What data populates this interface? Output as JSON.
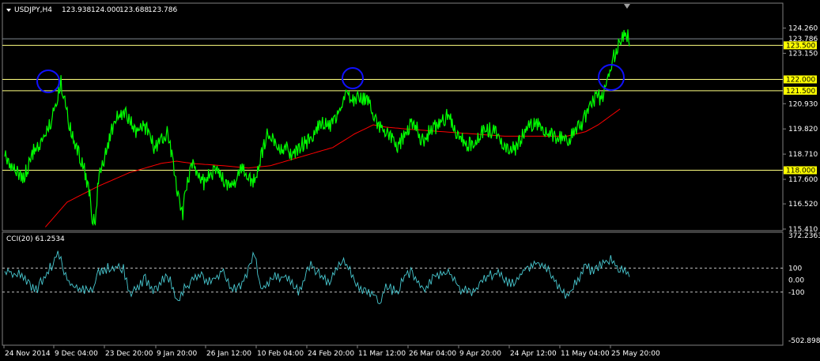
{
  "chart_data": [
    {
      "type": "line",
      "title": "USDJPY,H4",
      "ohlc": {
        "open": "123.938",
        "high": "124.000",
        "low": "123.688",
        "close": "123.786"
      },
      "ylim": [
        115.41,
        124.8
      ],
      "price_ticks": [
        "124.260",
        "123.150",
        "120.930",
        "119.820",
        "118.710",
        "117.600",
        "116.520",
        "115.410"
      ],
      "current_price": "123.786",
      "levels": [
        "123.500",
        "122.000",
        "121.500",
        "118.000"
      ],
      "x_labels": [
        "24 Nov 2014",
        "9 Dec 04:00",
        "23 Dec 20:00",
        "9 Jan 20:00",
        "26 Jan 12:00",
        "10 Feb 04:00",
        "24 Feb 20:00",
        "11 Mar 12:00",
        "26 Mar 04:00",
        "9 Apr 20:00",
        "24 Apr 12:00",
        "11 May 04:00",
        "25 May 20:00"
      ],
      "series": [
        {
          "color": "#00ff00",
          "anchors": [
            [
              0,
              118.6
            ],
            [
              3,
              118.0
            ],
            [
              6,
              117.6
            ],
            [
              9,
              118.8
            ],
            [
              12,
              119.3
            ],
            [
              15,
              120.2
            ],
            [
              17,
              121.3
            ],
            [
              18,
              121.9
            ],
            [
              19,
              121.2
            ],
            [
              21,
              119.8
            ],
            [
              23,
              119.0
            ],
            [
              25,
              118.3
            ],
            [
              27,
              117.1
            ],
            [
              28,
              116.0
            ],
            [
              29,
              115.8
            ],
            [
              30,
              117.5
            ],
            [
              32,
              118.6
            ],
            [
              34,
              119.7
            ],
            [
              36,
              120.3
            ],
            [
              38,
              120.6
            ],
            [
              40,
              120.2
            ],
            [
              42,
              119.6
            ],
            [
              44,
              120.0
            ],
            [
              46,
              119.8
            ],
            [
              48,
              118.9
            ],
            [
              50,
              119.3
            ],
            [
              52,
              119.6
            ],
            [
              54,
              118.4
            ],
            [
              55,
              117.2
            ],
            [
              56,
              116.5
            ],
            [
              57,
              116.1
            ],
            [
              58,
              117.2
            ],
            [
              60,
              118.3
            ],
            [
              62,
              117.8
            ],
            [
              64,
              117.4
            ],
            [
              66,
              117.9
            ],
            [
              68,
              118.0
            ],
            [
              70,
              117.6
            ],
            [
              72,
              117.3
            ],
            [
              74,
              117.5
            ],
            [
              76,
              118.1
            ],
            [
              78,
              117.7
            ],
            [
              80,
              117.5
            ],
            [
              82,
              118.6
            ],
            [
              84,
              119.6
            ],
            [
              86,
              119.3
            ],
            [
              88,
              118.9
            ],
            [
              90,
              119.0
            ],
            [
              92,
              118.7
            ],
            [
              94,
              119.0
            ],
            [
              96,
              119.2
            ],
            [
              98,
              119.4
            ],
            [
              100,
              119.9
            ],
            [
              102,
              120.1
            ],
            [
              104,
              119.9
            ],
            [
              106,
              120.4
            ],
            [
              108,
              120.8
            ],
            [
              110,
              121.6
            ],
            [
              111,
              121.0
            ],
            [
              113,
              121.2
            ],
            [
              115,
              121.1
            ],
            [
              117,
              120.9
            ],
            [
              118,
              120.3
            ],
            [
              120,
              119.9
            ],
            [
              122,
              119.7
            ],
            [
              124,
              119.3
            ],
            [
              126,
              119.0
            ],
            [
              128,
              119.6
            ],
            [
              130,
              120.0
            ],
            [
              132,
              119.8
            ],
            [
              134,
              119.2
            ],
            [
              136,
              119.7
            ],
            [
              138,
              119.9
            ],
            [
              140,
              120.2
            ],
            [
              142,
              120.4
            ],
            [
              144,
              119.8
            ],
            [
              146,
              119.4
            ],
            [
              148,
              119.1
            ],
            [
              150,
              119.2
            ],
            [
              152,
              119.5
            ],
            [
              154,
              119.9
            ],
            [
              156,
              119.7
            ],
            [
              158,
              119.6
            ],
            [
              160,
              119.1
            ],
            [
              162,
              118.9
            ],
            [
              164,
              119.0
            ],
            [
              166,
              119.6
            ],
            [
              168,
              119.9
            ],
            [
              170,
              120.1
            ],
            [
              172,
              119.8
            ],
            [
              174,
              119.6
            ],
            [
              176,
              119.5
            ],
            [
              178,
              119.4
            ],
            [
              180,
              119.2
            ],
            [
              182,
              119.6
            ],
            [
              184,
              119.9
            ],
            [
              186,
              120.4
            ],
            [
              188,
              121.0
            ],
            [
              190,
              121.3
            ],
            [
              191,
              121.1
            ],
            [
              192,
              121.6
            ],
            [
              194,
              122.3
            ],
            [
              195,
              123.0
            ],
            [
              197,
              123.6
            ],
            [
              199,
              124.0
            ],
            [
              200,
              123.8
            ]
          ]
        },
        {
          "color": "#ff0000",
          "anchors": [
            [
              13,
              115.5
            ],
            [
              20,
              116.6
            ],
            [
              30,
              117.3
            ],
            [
              40,
              117.9
            ],
            [
              50,
              118.3
            ],
            [
              55,
              118.4
            ],
            [
              60,
              118.3
            ],
            [
              70,
              118.2
            ],
            [
              78,
              118.1
            ],
            [
              85,
              118.2
            ],
            [
              95,
              118.6
            ],
            [
              105,
              119.0
            ],
            [
              112,
              119.6
            ],
            [
              118,
              120.0
            ],
            [
              122,
              119.9
            ],
            [
              130,
              119.8
            ],
            [
              140,
              119.7
            ],
            [
              150,
              119.6
            ],
            [
              160,
              119.5
            ],
            [
              170,
              119.5
            ],
            [
              180,
              119.5
            ],
            [
              186,
              119.7
            ],
            [
              190,
              120.0
            ],
            [
              194,
              120.4
            ],
            [
              197,
              120.7
            ]
          ]
        }
      ]
    },
    {
      "type": "line",
      "title": "CCI(20) 61.2534",
      "ylim": [
        -502.8983,
        372.2363
      ],
      "ticks": [
        "372.2363",
        "100",
        "0.00",
        "-100",
        "-502.8983"
      ],
      "series": [
        {
          "color": "#48c8d0",
          "anchors": [
            [
              0,
              80
            ],
            [
              5,
              40
            ],
            [
              10,
              -90
            ],
            [
              15,
              120
            ],
            [
              17,
              240
            ],
            [
              19,
              80
            ],
            [
              21,
              -40
            ],
            [
              25,
              -80
            ],
            [
              28,
              -100
            ],
            [
              30,
              60
            ],
            [
              34,
              110
            ],
            [
              38,
              100
            ],
            [
              40,
              -120
            ],
            [
              42,
              -80
            ],
            [
              45,
              10
            ],
            [
              48,
              -90
            ],
            [
              52,
              60
            ],
            [
              55,
              -160
            ],
            [
              58,
              -60
            ],
            [
              62,
              40
            ],
            [
              66,
              -20
            ],
            [
              70,
              90
            ],
            [
              72,
              -70
            ],
            [
              76,
              -40
            ],
            [
              80,
              230
            ],
            [
              82,
              -80
            ],
            [
              86,
              20
            ],
            [
              90,
              30
            ],
            [
              94,
              -100
            ],
            [
              98,
              130
            ],
            [
              100,
              60
            ],
            [
              104,
              -30
            ],
            [
              108,
              180
            ],
            [
              110,
              110
            ],
            [
              112,
              -30
            ],
            [
              115,
              -90
            ],
            [
              118,
              -120
            ],
            [
              120,
              -200
            ],
            [
              122,
              -60
            ],
            [
              126,
              -100
            ],
            [
              128,
              40
            ],
            [
              130,
              70
            ],
            [
              134,
              -90
            ],
            [
              138,
              40
            ],
            [
              142,
              70
            ],
            [
              146,
              -80
            ],
            [
              150,
              -100
            ],
            [
              154,
              30
            ],
            [
              158,
              60
            ],
            [
              162,
              -40
            ],
            [
              166,
              80
            ],
            [
              170,
              140
            ],
            [
              174,
              90
            ],
            [
              178,
              -80
            ],
            [
              180,
              -150
            ],
            [
              184,
              30
            ],
            [
              186,
              110
            ],
            [
              188,
              80
            ],
            [
              190,
              120
            ],
            [
              192,
              150
            ],
            [
              194,
              170
            ],
            [
              196,
              110
            ],
            [
              198,
              90
            ],
            [
              200,
              61
            ]
          ]
        }
      ]
    }
  ]
}
